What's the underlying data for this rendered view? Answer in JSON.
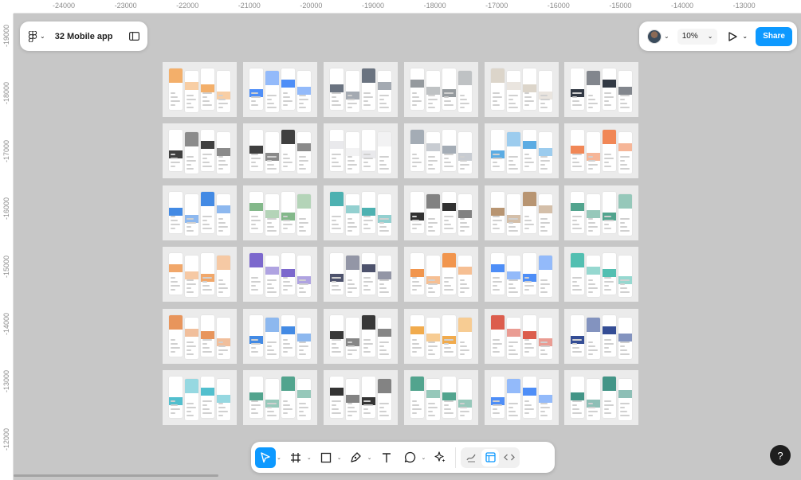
{
  "file": {
    "title": "32 Mobile app"
  },
  "ruler": {
    "top": [
      "-24000",
      "-23000",
      "-22000",
      "-21000",
      "-20000",
      "-19000",
      "-18000",
      "-17000",
      "-16000",
      "-15000",
      "-14000",
      "-13000"
    ],
    "left": [
      "-19000",
      "-18000",
      "-17000",
      "-16000",
      "-15000",
      "-14000",
      "-13000",
      "-12000"
    ]
  },
  "header": {
    "zoom": "10%",
    "share_label": "Share"
  },
  "help": {
    "label": "?"
  },
  "colors": {
    "accent": "#0d99ff",
    "canvas": "#c7c7c7",
    "frame": "#ebebeb"
  },
  "toolbar": {
    "tools": [
      "move-tool",
      "frame-tool",
      "shape-tool",
      "pen-tool",
      "text-tool",
      "comment-tool",
      "actions-tool"
    ],
    "modes": [
      "draw-mode",
      "design-mode",
      "dev-mode"
    ],
    "active_tool": "move-tool",
    "active_mode": "design-mode"
  },
  "frames": {
    "rows": 6,
    "cols": 6,
    "accent_colors": [
      [
        "#f2a65a",
        "#3b82f6",
        "#5a6472",
        "#8a8f94",
        "#d8d0c4",
        "#1c2330"
      ],
      [
        "#2b2b2b",
        "#2a2a2a",
        "#e7e7ea",
        "#9aa3ad",
        "#4aa3e0",
        "#ef7a44"
      ],
      [
        "#2f7de1",
        "#76b07d",
        "#3aa9a9",
        "#1a1a1a",
        "#b08a63",
        "#3f9a82"
      ],
      [
        "#ef9d5a",
        "#6e58c8",
        "#3a3f5c",
        "#ef8a3a",
        "#3b82f6",
        "#3fb8a9"
      ],
      [
        "#e58a4a",
        "#2f7de1",
        "#222222",
        "#f0a23a",
        "#d84b3a",
        "#1e3a8a"
      ],
      [
        "#3fb8c9",
        "#3f9a82",
        "#1e1e1e",
        "#3f9a82",
        "#3b82f6",
        "#2f8a7a"
      ]
    ]
  }
}
